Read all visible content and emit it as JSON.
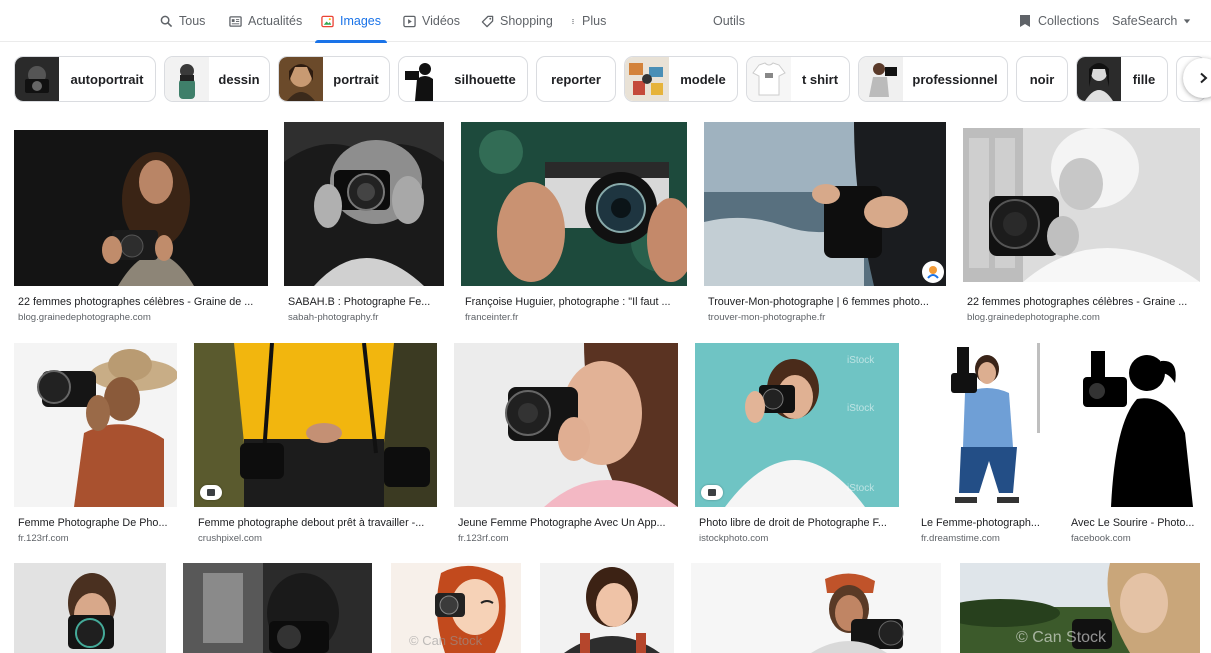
{
  "nav": {
    "tabs": [
      {
        "label": "Tous",
        "icon": "search-icon"
      },
      {
        "label": "Actualités",
        "icon": "news-icon"
      },
      {
        "label": "Images",
        "icon": "image-icon",
        "active": true
      },
      {
        "label": "Vidéos",
        "icon": "play-icon"
      },
      {
        "label": "Shopping",
        "icon": "tag-icon"
      },
      {
        "label": "Plus",
        "icon": "more-vert-icon"
      }
    ],
    "tools": "Outils",
    "collections": "Collections",
    "safesearch": "SafeSearch"
  },
  "chips": [
    {
      "label": "autoportrait"
    },
    {
      "label": "dessin"
    },
    {
      "label": "portrait"
    },
    {
      "label": "silhouette"
    },
    {
      "label": "reporter"
    },
    {
      "label": "modele"
    },
    {
      "label": "t shirt"
    },
    {
      "label": "professionnel"
    },
    {
      "label": "noir"
    },
    {
      "label": "fille"
    }
  ],
  "results": [
    {
      "title": "22 femmes photographes célèbres - Graine de ...",
      "source": "blog.grainedephotographe.com"
    },
    {
      "title": "SABAH.B : Photographe Fe...",
      "source": "sabah-photography.fr"
    },
    {
      "title": "Françoise Huguier, photographe : \"Il faut ...",
      "source": "franceinter.fr"
    },
    {
      "title": "Trouver-Mon-photographe | 6 femmes photo...",
      "source": "trouver-mon-photographe.fr"
    },
    {
      "title": "22 femmes photographes célèbres - Graine ...",
      "source": "blog.grainedephotographe.com"
    },
    {
      "title": "Femme Photographe De Pho...",
      "source": "fr.123rf.com"
    },
    {
      "title": "Femme photographe debout prêt à travailler -...",
      "source": "crushpixel.com"
    },
    {
      "title": "Jeune Femme Photographe Avec Un App...",
      "source": "fr.123rf.com"
    },
    {
      "title": "Photo libre de droit de Photographe F...",
      "source": "istockphoto.com"
    },
    {
      "title": "Le Femme-photograph...",
      "source": "fr.dreamstime.com"
    },
    {
      "title": "Avec Le Sourire - Photo...",
      "source": "facebook.com"
    }
  ],
  "watermarks": {
    "istock": "iStock",
    "canstock": "© Can Stock"
  }
}
